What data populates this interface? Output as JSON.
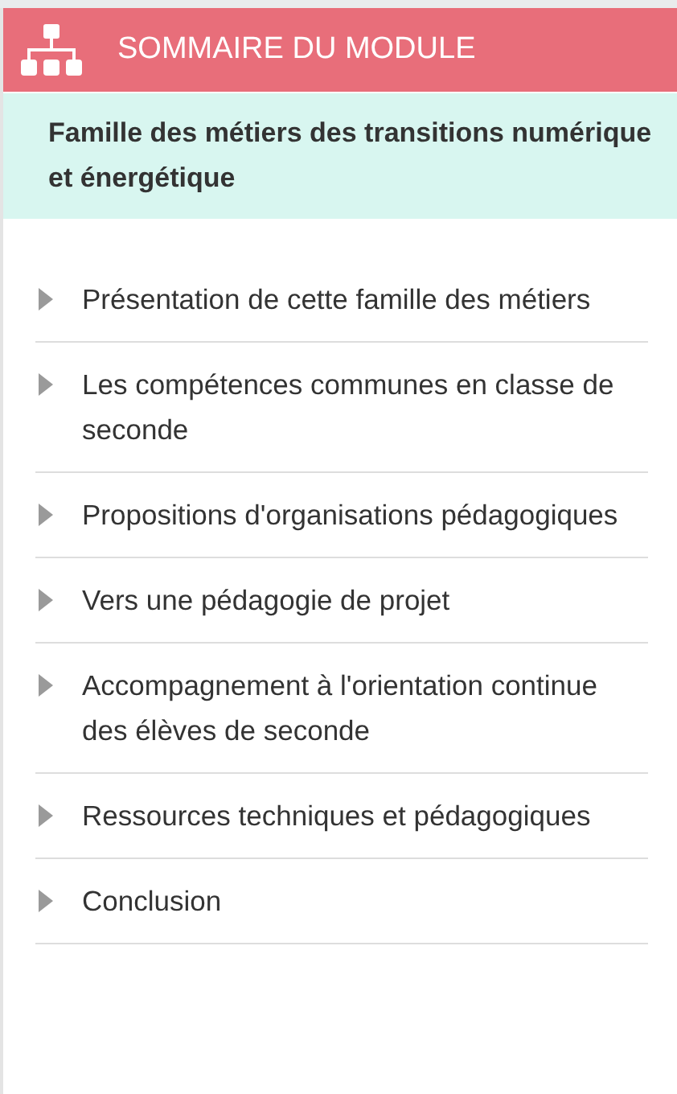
{
  "header": {
    "title": "SOMMAIRE DU MODULE"
  },
  "module": {
    "title": "Famille des métiers des transitions numérique et énergétique"
  },
  "items": [
    {
      "label": "Présentation de cette famille des métiers",
      "expanded": false
    },
    {
      "label": "Les compétences communes en classe de seconde",
      "expanded": false
    },
    {
      "label": "Propositions d'organisations pédagogiques",
      "expanded": false
    },
    {
      "label": "Vers une pédagogie de projet",
      "expanded": false
    },
    {
      "label": "Accompagnement à l'orientation continue des élèves de seconde",
      "expanded": false
    },
    {
      "label": "Ressources techniques et pédagogiques",
      "expanded": false
    },
    {
      "label": "Conclusion",
      "expanded": false
    }
  ]
}
